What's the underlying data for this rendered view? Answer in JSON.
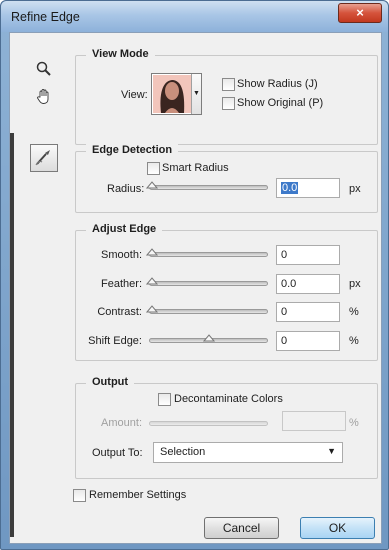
{
  "window": {
    "title": "Refine Edge",
    "close_glyph": "×"
  },
  "tools": [
    "zoom-icon",
    "hand-icon",
    "refine-radius-brush-icon"
  ],
  "view_mode": {
    "title": "View Mode",
    "view_label": "View:",
    "show_radius_label": "Show Radius (J)",
    "show_original_label": "Show Original (P)"
  },
  "edge_detection": {
    "title": "Edge Detection",
    "smart_radius_label": "Smart Radius",
    "radius_label": "Radius:",
    "radius_value": "0.0",
    "radius_unit": "px"
  },
  "adjust_edge": {
    "title": "Adjust Edge",
    "smooth_label": "Smooth:",
    "smooth_value": "0",
    "feather_label": "Feather:",
    "feather_value": "0.0",
    "feather_unit": "px",
    "contrast_label": "Contrast:",
    "contrast_value": "0",
    "contrast_unit": "%",
    "shift_label": "Shift Edge:",
    "shift_value": "0",
    "shift_unit": "%",
    "shift_edge_level": 0.5
  },
  "output": {
    "title": "Output",
    "decontaminate_label": "Decontaminate Colors",
    "amount_label": "Amount:",
    "amount_unit": "%",
    "output_to_label": "Output To:",
    "output_to_value": "Selection"
  },
  "remember_label": "Remember Settings",
  "buttons": {
    "cancel": "Cancel",
    "ok": "OK"
  },
  "colors": {
    "title_bar": "#a9c6e6",
    "close_button": "#d5533c",
    "dialog_bg": "#f0f0f0",
    "ok_button": "#c4e2f7"
  }
}
